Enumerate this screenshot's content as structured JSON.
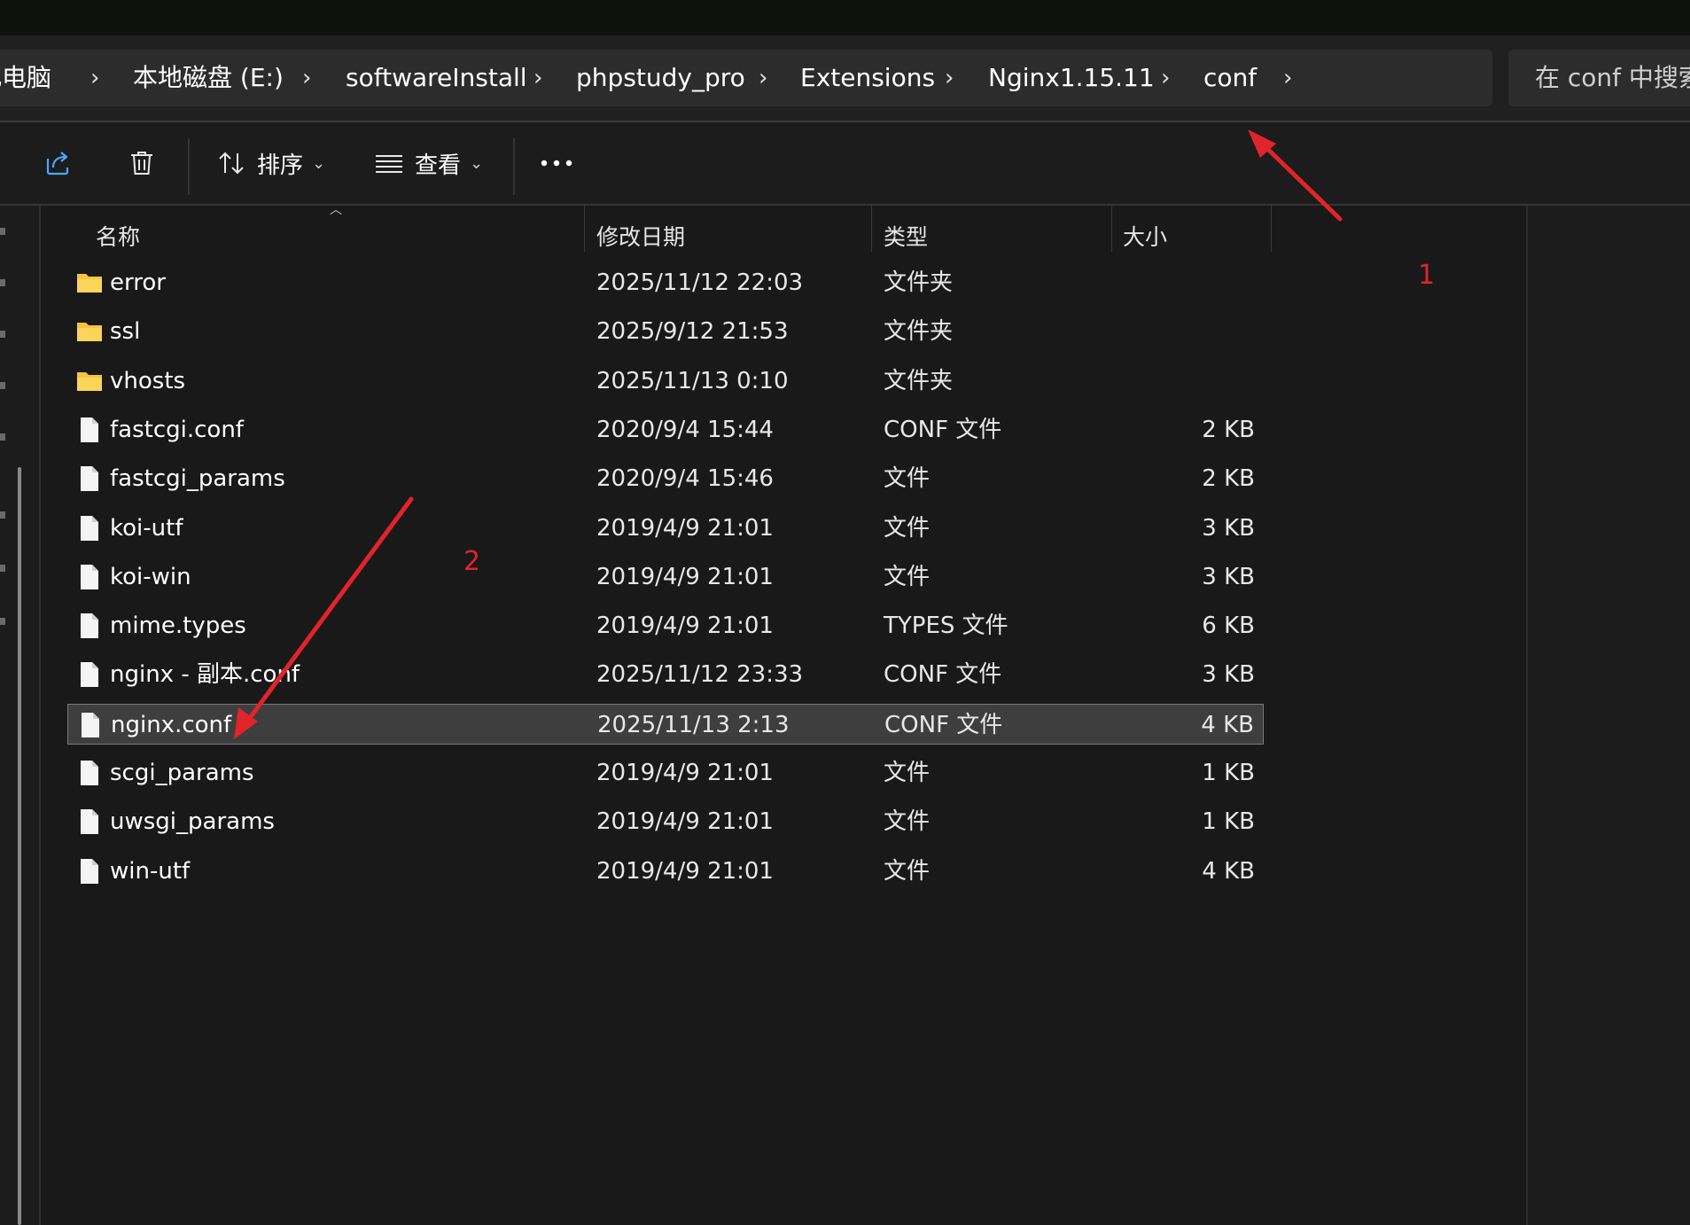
{
  "breadcrumb": {
    "items": [
      "此电脑",
      "本地磁盘 (E:)",
      "softwareInstall",
      "phpstudy_pro",
      "Extensions",
      "Nginx1.15.11",
      "conf"
    ]
  },
  "search": {
    "placeholder": "在 conf 中搜索"
  },
  "toolbar": {
    "share_icon": "share-icon",
    "delete_icon": "trash-icon",
    "sort_label": "排序",
    "view_label": "查看",
    "more_icon": "more-horizontal-icon"
  },
  "columns": {
    "name": "名称",
    "date": "修改日期",
    "type": "类型",
    "size": "大小"
  },
  "files": [
    {
      "name": "error",
      "date": "2025/11/12 22:03",
      "type": "文件夹",
      "size": "",
      "kind": "folder"
    },
    {
      "name": "ssl",
      "date": "2025/9/12 21:53",
      "type": "文件夹",
      "size": "",
      "kind": "folder"
    },
    {
      "name": "vhosts",
      "date": "2025/11/13 0:10",
      "type": "文件夹",
      "size": "",
      "kind": "folder"
    },
    {
      "name": "fastcgi.conf",
      "date": "2020/9/4 15:44",
      "type": "CONF 文件",
      "size": "2 KB",
      "kind": "file"
    },
    {
      "name": "fastcgi_params",
      "date": "2020/9/4 15:46",
      "type": "文件",
      "size": "2 KB",
      "kind": "file"
    },
    {
      "name": "koi-utf",
      "date": "2019/4/9 21:01",
      "type": "文件",
      "size": "3 KB",
      "kind": "file"
    },
    {
      "name": "koi-win",
      "date": "2019/4/9 21:01",
      "type": "文件",
      "size": "3 KB",
      "kind": "file"
    },
    {
      "name": "mime.types",
      "date": "2019/4/9 21:01",
      "type": "TYPES 文件",
      "size": "6 KB",
      "kind": "file"
    },
    {
      "name": "nginx - 副本.conf",
      "date": "2025/11/12 23:33",
      "type": "CONF 文件",
      "size": "3 KB",
      "kind": "file"
    },
    {
      "name": "nginx.conf",
      "date": "2025/11/13 2:13",
      "type": "CONF 文件",
      "size": "4 KB",
      "kind": "file",
      "selected": true
    },
    {
      "name": "scgi_params",
      "date": "2019/4/9 21:01",
      "type": "文件",
      "size": "1 KB",
      "kind": "file"
    },
    {
      "name": "uwsgi_params",
      "date": "2019/4/9 21:01",
      "type": "文件",
      "size": "1 KB",
      "kind": "file"
    },
    {
      "name": "win-utf",
      "date": "2019/4/9 21:01",
      "type": "文件",
      "size": "4 KB",
      "kind": "file"
    }
  ],
  "annotations": {
    "label_1": "1",
    "label_2": "2",
    "color": "#e1232b"
  },
  "colors": {
    "folder": "#f7c43c",
    "selection": "#3e3e3e",
    "background": "#191919"
  }
}
